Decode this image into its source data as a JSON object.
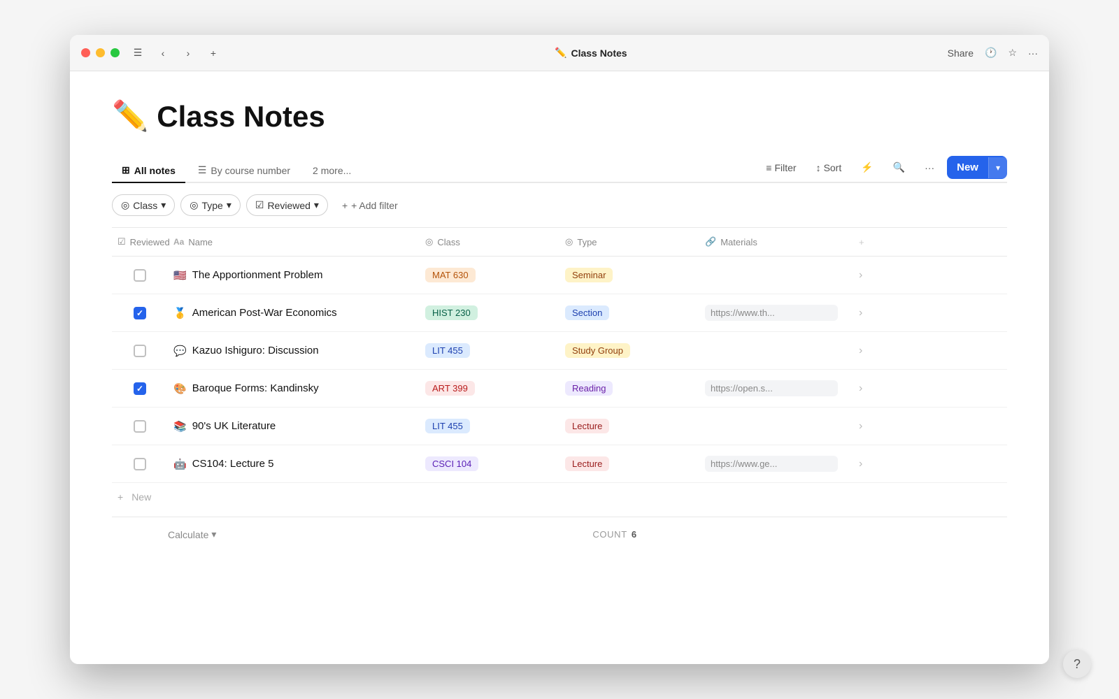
{
  "window": {
    "title": "Class Notes",
    "emoji": "✏️"
  },
  "titlebar": {
    "title": "Class Notes",
    "share_label": "Share",
    "more_label": "···"
  },
  "tabs": [
    {
      "id": "all-notes",
      "label": "All notes",
      "active": true,
      "icon": "table-icon"
    },
    {
      "id": "by-course",
      "label": "By course number",
      "active": false,
      "icon": "list-icon"
    },
    {
      "id": "more",
      "label": "2 more...",
      "active": false
    }
  ],
  "actions": {
    "filter_label": "Filter",
    "sort_label": "Sort",
    "more_label": "···",
    "new_label": "New"
  },
  "filters": [
    {
      "id": "class-filter",
      "label": "Class",
      "icon": "filter-circle-icon"
    },
    {
      "id": "type-filter",
      "label": "Type",
      "icon": "filter-circle-icon"
    },
    {
      "id": "reviewed-filter",
      "label": "Reviewed",
      "icon": "checkbox-icon"
    }
  ],
  "add_filter_label": "+ Add filter",
  "columns": [
    {
      "id": "reviewed",
      "label": "Reviewed",
      "icon": "checkbox-col-icon"
    },
    {
      "id": "name",
      "label": "Name",
      "icon": "text-icon"
    },
    {
      "id": "class",
      "label": "Class",
      "icon": "circle-icon"
    },
    {
      "id": "type",
      "label": "Type",
      "icon": "circle-icon"
    },
    {
      "id": "materials",
      "label": "Materials",
      "icon": "link-icon"
    }
  ],
  "rows": [
    {
      "id": "row-1",
      "reviewed": false,
      "emoji": "🇺🇸",
      "name": "The Apportionment Problem",
      "class_label": "MAT 630",
      "class_badge": "mat",
      "type_label": "Seminar",
      "type_badge": "seminar",
      "materials": "",
      "has_more": true
    },
    {
      "id": "row-2",
      "reviewed": true,
      "emoji": "🥇",
      "name": "American Post-War Economics",
      "class_label": "HIST 230",
      "class_badge": "hist",
      "type_label": "Section",
      "type_badge": "section",
      "materials": "https://www.th...",
      "has_more": true
    },
    {
      "id": "row-3",
      "reviewed": false,
      "emoji": "💬",
      "name": "Kazuo Ishiguro: Discussion",
      "class_label": "LIT 455",
      "class_badge": "lit",
      "type_label": "Study Group",
      "type_badge": "study",
      "materials": "",
      "has_more": true
    },
    {
      "id": "row-4",
      "reviewed": true,
      "emoji": "🎨",
      "name": "Baroque Forms: Kandinsky",
      "class_label": "ART 399",
      "class_badge": "art",
      "type_label": "Reading",
      "type_badge": "reading",
      "materials": "https://open.s...",
      "has_more": true
    },
    {
      "id": "row-5",
      "reviewed": false,
      "emoji": "📚",
      "name": "90's UK Literature",
      "class_label": "LIT 455",
      "class_badge": "lit",
      "type_label": "Lecture",
      "type_badge": "lecture",
      "materials": "",
      "has_more": true
    },
    {
      "id": "row-6",
      "reviewed": false,
      "emoji": "🤖",
      "name": "CS104: Lecture 5",
      "class_label": "CSCI 104",
      "class_badge": "csci",
      "type_label": "Lecture",
      "type_badge": "lecture",
      "materials": "https://www.ge...",
      "has_more": true
    }
  ],
  "footer": {
    "new_label": "New",
    "calculate_label": "Calculate",
    "count_label": "COUNT",
    "count_value": "6"
  },
  "help": "?"
}
